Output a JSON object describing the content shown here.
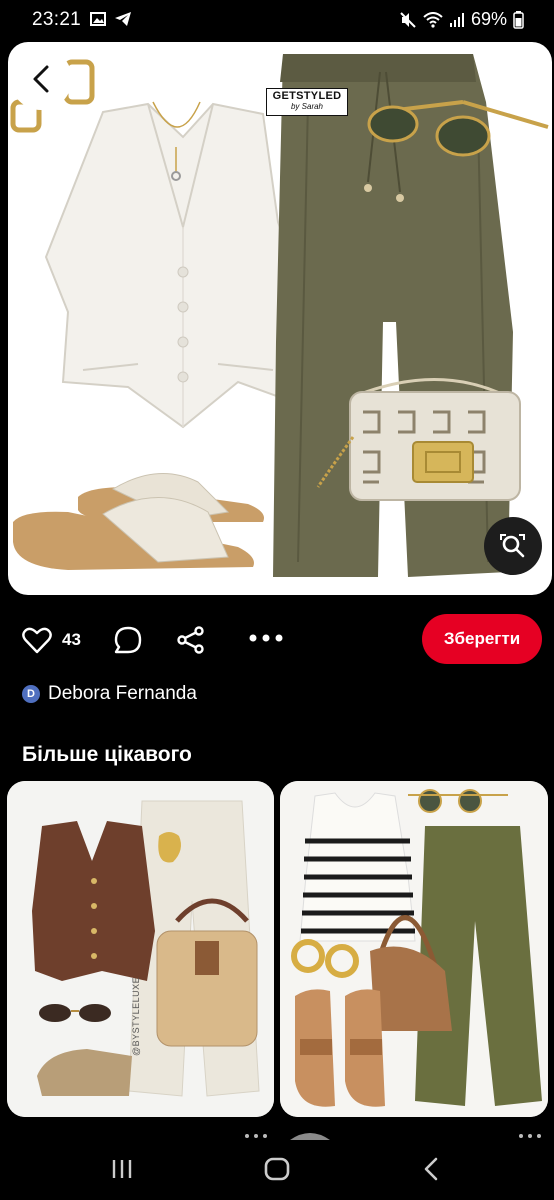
{
  "status_bar": {
    "time": "23:21",
    "battery": "69%"
  },
  "pin": {
    "watermark_line1": "GETSTYLED",
    "watermark_line2": "by Sarah",
    "like_count": "43",
    "save_label": "Зберегти",
    "author_initial": "D",
    "author_name": "Debora Fernanda"
  },
  "more": {
    "title": "Більше цікавого",
    "cards": [
      {
        "watermark": "@BYSTYLELUXE"
      },
      {
        "watermark": ""
      }
    ]
  },
  "colors": {
    "accent": "#e60023",
    "background": "#000000",
    "olive": "#6b6a4e"
  }
}
